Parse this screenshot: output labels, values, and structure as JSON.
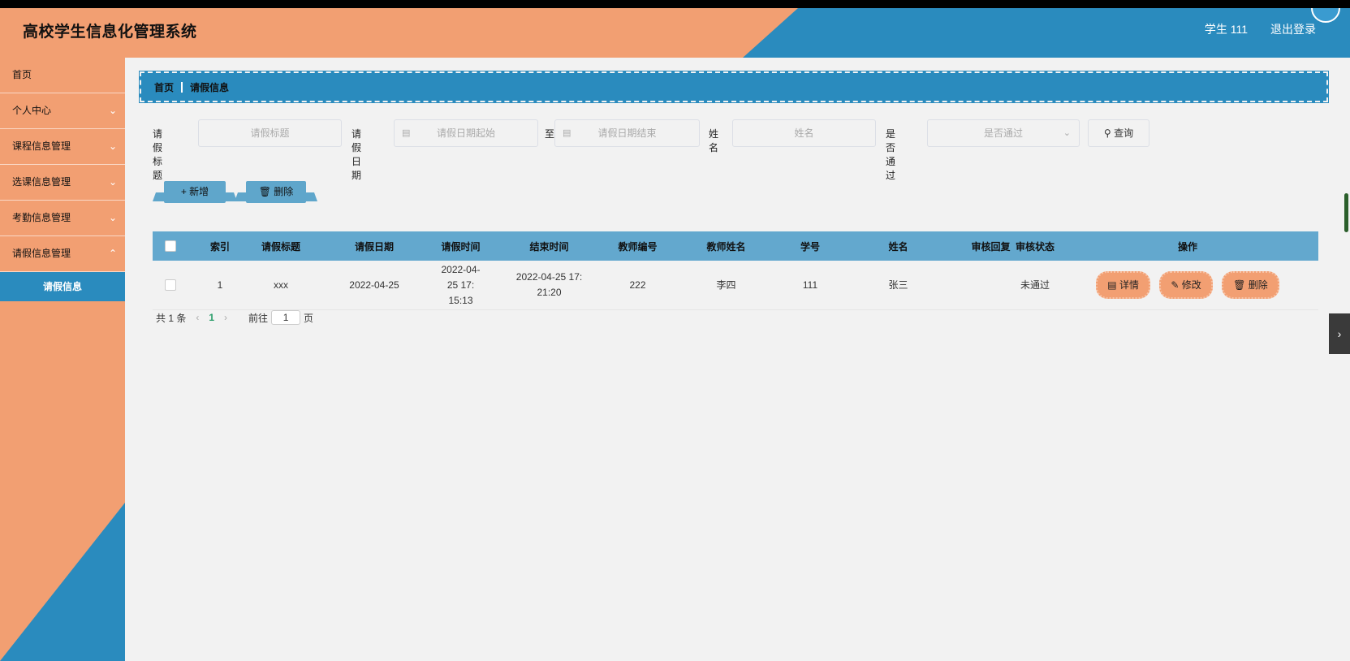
{
  "header": {
    "title": "高校学生信息化管理系统",
    "user": "学生 111",
    "logout": "退出登录"
  },
  "sidebar": {
    "items": [
      {
        "label": "首页"
      },
      {
        "label": "个人中心"
      },
      {
        "label": "课程信息管理"
      },
      {
        "label": "选课信息管理"
      },
      {
        "label": "考勤信息管理"
      },
      {
        "label": "请假信息管理"
      }
    ],
    "active_sub": "请假信息"
  },
  "breadcrumb": {
    "home": "首页",
    "current": "请假信息"
  },
  "search": {
    "title_label": "请假标题",
    "title_placeholder": "请假标题",
    "date_label": "请假日期",
    "date_start_placeholder": "请假日期起始",
    "to": "至",
    "date_end_placeholder": "请假日期结束",
    "name_label": "姓名",
    "name_placeholder": "姓名",
    "passed_label": "是否通过",
    "passed_placeholder": "是否通过",
    "query_button": "查询"
  },
  "actions": {
    "add": "新增",
    "delete": "删除"
  },
  "table": {
    "columns": [
      "索引",
      "请假标题",
      "请假日期",
      "请假时间",
      "结束时间",
      "教师编号",
      "教师姓名",
      "学号",
      "姓名",
      "审核回复",
      "审核状态",
      "操作"
    ],
    "rows": [
      {
        "index": "1",
        "title": "xxx",
        "date": "2022-04-25",
        "start_time_1": "2022-04-25 17:",
        "start_time_2": "15:13",
        "end_time_1": "2022-04-25 17:",
        "end_time_2": "21:20",
        "teacher_no": "222",
        "teacher_name": "李四",
        "student_no": "111",
        "name": "张三",
        "reply": "",
        "status": "未通过"
      }
    ],
    "row_actions": {
      "detail": "详情",
      "edit": "修改",
      "delete": "删除"
    }
  },
  "pagination": {
    "total": "共 1 条",
    "current_page": "1",
    "goto_label": "前往",
    "goto_value": "1",
    "page_suffix": "页"
  },
  "colors": {
    "orange": "#f29f72",
    "blue": "#2a8bbe",
    "header_row": "#63a8ce"
  }
}
